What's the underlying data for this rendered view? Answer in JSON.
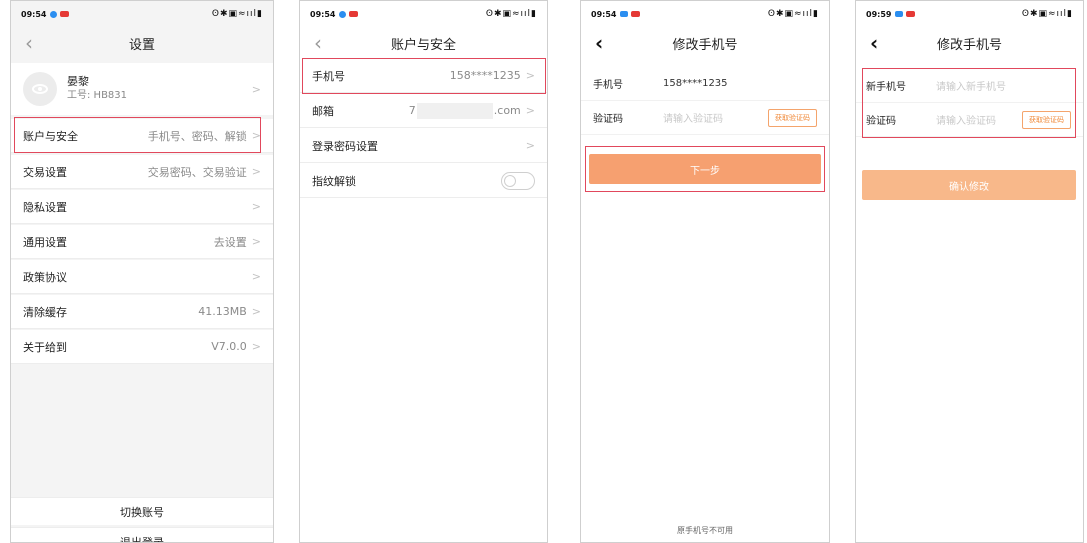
{
  "panel1": {
    "status": {
      "time": "09:54",
      "icons": "ʘ✱▣≈ııl▮"
    },
    "title": "设置",
    "back_icon": "‹",
    "profile": {
      "name": "晏黎",
      "id_label": "工号: HB831"
    },
    "rows": [
      {
        "label": "账户与安全",
        "value": "手机号、密码、解锁"
      },
      {
        "label": "交易设置",
        "value": "交易密码、交易验证"
      },
      {
        "label": "隐私设置",
        "value": ""
      },
      {
        "label": "通用设置",
        "value": "去设置"
      },
      {
        "label": "政策协议",
        "value": ""
      },
      {
        "label": "清除缓存",
        "value": "41.13MB"
      },
      {
        "label": "关于给到",
        "value": "V7.0.0"
      }
    ],
    "switch_account": "切换账号",
    "logout": "退出登录"
  },
  "panel2": {
    "status": {
      "time": "09:54",
      "icons": "ʘ✱▣≈ııl▮"
    },
    "title": "账户与安全",
    "rows": [
      {
        "label": "手机号",
        "value": "158****1235"
      },
      {
        "label": "邮箱",
        "value_prefix": "7",
        "value_suffix": ".com"
      },
      {
        "label": "登录密码设置",
        "value": ""
      },
      {
        "label": "指纹解锁",
        "value": ""
      }
    ]
  },
  "panel3": {
    "status": {
      "time": "09:54",
      "icons": "ʘ✱▣≈ııl▮"
    },
    "title": "修改手机号",
    "phone_label": "手机号",
    "phone_value": "158****1235",
    "code_label": "验证码",
    "code_placeholder": "请输入验证码",
    "get_code": "获取验证码",
    "next": "下一步",
    "footer": "原手机号不可用"
  },
  "panel4": {
    "status": {
      "time": "09:59",
      "icons": "ʘ✱▣≈ııl▮"
    },
    "title": "修改手机号",
    "new_phone_label": "新手机号",
    "new_phone_placeholder": "请输入新手机号",
    "code_label": "验证码",
    "code_placeholder": "请输入验证码",
    "get_code": "获取验证码",
    "confirm": "确认修改"
  },
  "colors": {
    "accent": "#f6a070",
    "highlight": "#e1485c"
  }
}
